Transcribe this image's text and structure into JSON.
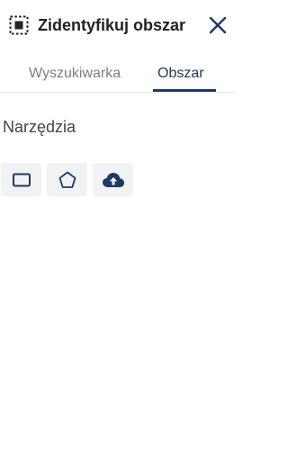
{
  "header": {
    "title": "Zidentyfikuj obszar",
    "icon": "area-select-icon",
    "close_icon": "close-icon"
  },
  "tabs": [
    {
      "label": "Wyszukiwarka",
      "active": false
    },
    {
      "label": "Obszar",
      "active": true
    }
  ],
  "tools": {
    "title": "Narzędzia",
    "items": [
      {
        "icon": "rectangle-icon"
      },
      {
        "icon": "polygon-icon"
      },
      {
        "icon": "cloud-upload-icon"
      }
    ]
  },
  "colors": {
    "accent": "#1f3864",
    "tab_inactive": "#7a7f87",
    "tool_background": "#f1f2f4"
  }
}
